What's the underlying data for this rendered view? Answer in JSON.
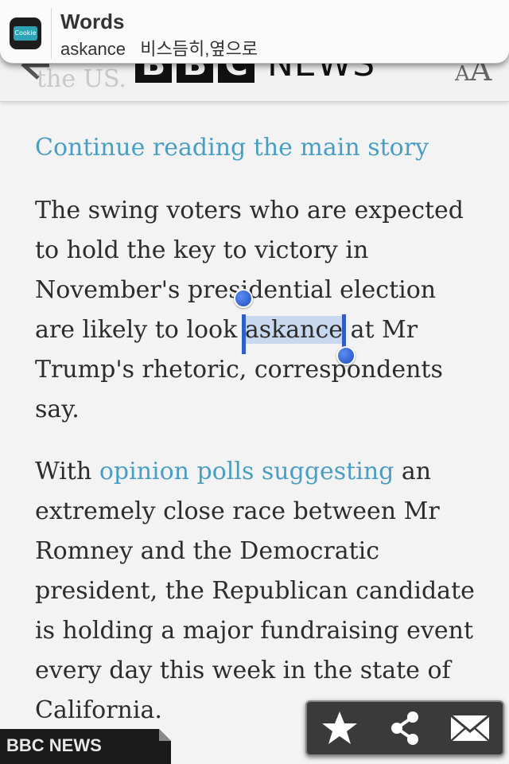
{
  "notification": {
    "title": "Words",
    "body": "askance   비스듬히,옆으로",
    "app_icon_label": "Cookie"
  },
  "header": {
    "faded_text": "the US.",
    "logo_letters": [
      "B",
      "B",
      "C"
    ],
    "logo_word": "NEWS",
    "text_size_small": "A",
    "text_size_large": "A"
  },
  "article": {
    "continue_link": "Continue reading the main story",
    "para1": {
      "before": "The swing voters who are expected to hold the key to victory in November's presidential election are likely to look ",
      "selected": "askance",
      "after": " at Mr Trump's rhetoric, correspondents say."
    },
    "para2": {
      "before": "With ",
      "link": "opinion polls suggesting",
      "after": " an extremely close race between Mr Romney and the Democratic president, the Republican candidate is holding a major fundraising event every day this week in the state of California."
    }
  },
  "footer": {
    "tag": "BBC NEWS"
  },
  "toolbar": {
    "icons": [
      "star-icon",
      "share-icon",
      "mail-icon"
    ]
  },
  "colors": {
    "link": "#4a9ec4",
    "selection": "#c8d8ee",
    "selection_handle": "#2f5ec8"
  }
}
